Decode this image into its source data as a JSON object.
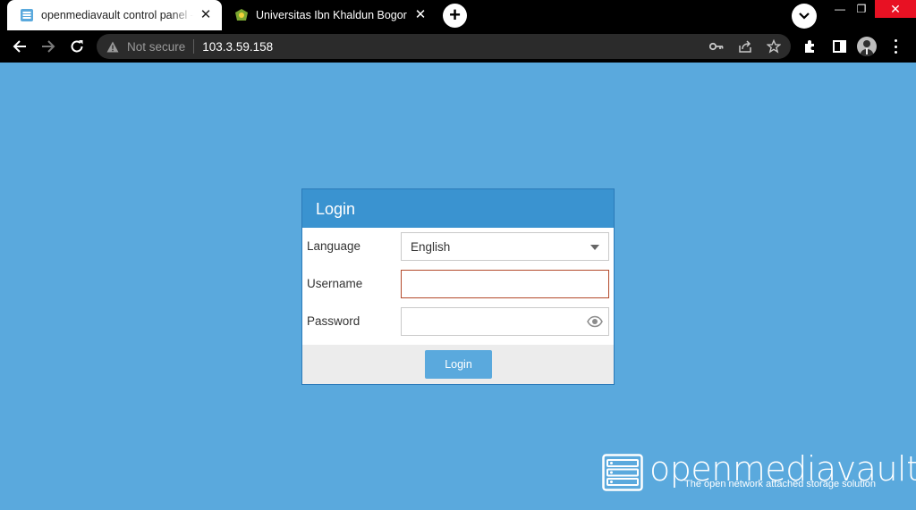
{
  "browser": {
    "tabs": [
      {
        "title": "openmediavault control panel - my",
        "active": true
      },
      {
        "title": "Universitas Ibn Khaldun Bogor",
        "active": false
      }
    ],
    "address": {
      "security_label": "Not secure",
      "url": "103.3.59.158"
    }
  },
  "login": {
    "title": "Login",
    "language_label": "Language",
    "language_value": "English",
    "username_label": "Username",
    "username_value": "",
    "password_label": "Password",
    "password_value": "",
    "submit_label": "Login"
  },
  "brand": {
    "name": "openmediavault",
    "tagline": "The open network attached storage solution"
  },
  "colors": {
    "page_background": "#5aa9dd",
    "header_blue": "#3a93d0",
    "focus_border": "#b34a2b",
    "close_red": "#e81123"
  },
  "icons": [
    "omv-favicon",
    "uika-favicon",
    "close-icon",
    "plus-icon",
    "chevron-down-icon",
    "back-arrow-icon",
    "forward-arrow-icon",
    "reload-icon",
    "warning-icon",
    "key-icon",
    "share-icon",
    "star-icon",
    "extension-icon",
    "sidepanel-icon",
    "kebab-menu-icon",
    "dropdown-arrow-icon",
    "eye-icon",
    "omv-logo-icon"
  ]
}
